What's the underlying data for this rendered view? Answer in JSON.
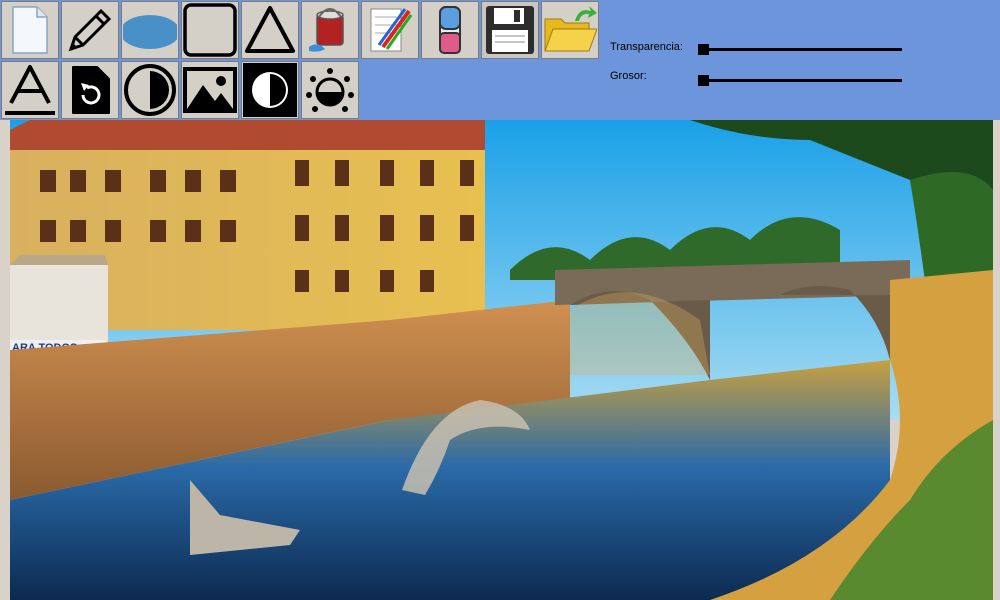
{
  "toolbar": {
    "tools_row1": [
      {
        "icon": "new-file-icon"
      },
      {
        "icon": "pencil-icon"
      },
      {
        "icon": "ellipse-icon"
      },
      {
        "icon": "rectangle-icon"
      },
      {
        "icon": "triangle-icon"
      },
      {
        "icon": "paint-bucket-icon"
      },
      {
        "icon": "color-palette-icon"
      },
      {
        "icon": "eraser-icon"
      },
      {
        "icon": "save-icon"
      },
      {
        "icon": "open-folder-icon"
      }
    ],
    "tools_row2": [
      {
        "icon": "text-icon"
      },
      {
        "icon": "rotate-icon"
      },
      {
        "icon": "contrast-icon"
      },
      {
        "icon": "image-icon"
      },
      {
        "icon": "invert-icon"
      },
      {
        "icon": "brightness-icon"
      }
    ]
  },
  "controls": {
    "transparency_label": "Transparencia:",
    "transparency_value": 0,
    "thickness_label": "Grosor:",
    "thickness_value": 0
  },
  "canvas": {
    "image_subject": "river-bridge-photo",
    "sign_text": "ARA TODOS"
  },
  "colors": {
    "toolbar_bg": "#6c95dc",
    "button_bg": "#d4d0c8",
    "ellipse_fill": "#4a90c8"
  }
}
